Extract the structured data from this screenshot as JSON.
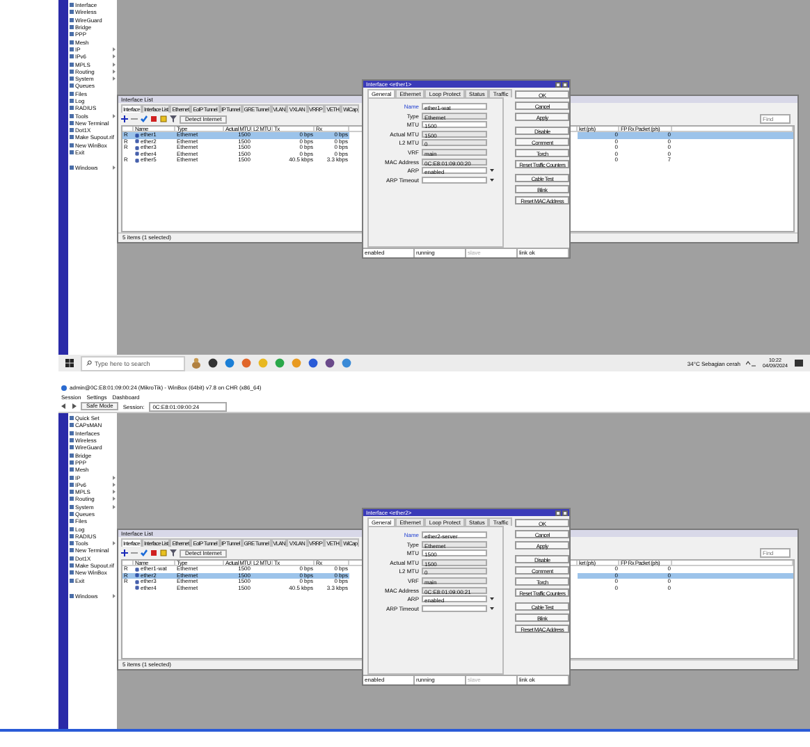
{
  "screens": [
    {
      "sidebar": {
        "items": [
          {
            "label": "Interface",
            "submenu": false
          },
          {
            "label": "Wireless",
            "submenu": false
          },
          {
            "label": "WireGuard",
            "submenu": false
          },
          {
            "label": "Bridge",
            "submenu": false
          },
          {
            "label": "PPP",
            "submenu": false
          },
          {
            "label": "Mesh",
            "submenu": false
          },
          {
            "label": "IP",
            "submenu": true
          },
          {
            "label": "IPv6",
            "submenu": true
          },
          {
            "label": "MPLS",
            "submenu": true
          },
          {
            "label": "Routing",
            "submenu": true
          },
          {
            "label": "System",
            "submenu": true
          },
          {
            "label": "Queues",
            "submenu": false
          },
          {
            "label": "Files",
            "submenu": false
          },
          {
            "label": "Log",
            "submenu": false
          },
          {
            "label": "RADIUS",
            "submenu": false
          },
          {
            "label": "Tools",
            "submenu": true
          },
          {
            "label": "New Terminal",
            "submenu": false
          },
          {
            "label": "Dot1X",
            "submenu": false
          },
          {
            "label": "Make Supout.rif",
            "submenu": false
          },
          {
            "label": "New WinBox",
            "submenu": false
          },
          {
            "label": "Exit",
            "submenu": false
          },
          {
            "label": "Windows",
            "submenu": true
          }
        ]
      },
      "interface_list": {
        "title": "Interface List",
        "tabs": [
          {
            "label": "Interface",
            "selected": true
          },
          {
            "label": "Interface List",
            "selected": false
          },
          {
            "label": "Ethernet",
            "selected": false
          },
          {
            "label": "EoIP Tunnel",
            "selected": false
          },
          {
            "label": "IP Tunnel",
            "selected": false
          },
          {
            "label": "GRE Tunnel",
            "selected": false
          },
          {
            "label": "VLAN",
            "selected": false
          },
          {
            "label": "VXLAN",
            "selected": false
          },
          {
            "label": "VRRP",
            "selected": false
          },
          {
            "label": "VETH",
            "selected": false
          },
          {
            "label": "WiCap",
            "selected": false
          }
        ],
        "toolbar_button": "Detect Internet",
        "find_placeholder": "Find",
        "columns": [
          "Name",
          "Type",
          "Actual MTU",
          "L2 MTU",
          "Tx",
          "Rx",
          "ket (p/s)",
          "FP Rx Packet (p/s)"
        ],
        "rows": [
          {
            "flag": "R",
            "name": "ether1",
            "type": "Ethernet",
            "mtu": "1500",
            "l2mtu": "",
            "tx": "0 bps",
            "rx": "0 bps",
            "fp_tx": "0",
            "fp_rx": "0",
            "selected": true
          },
          {
            "flag": "R",
            "name": "ether2",
            "type": "Ethernet",
            "mtu": "1500",
            "l2mtu": "",
            "tx": "0 bps",
            "rx": "0 bps",
            "fp_tx": "0",
            "fp_rx": "0",
            "selected": false
          },
          {
            "flag": "R",
            "name": "ether3",
            "type": "Ethernet",
            "mtu": "1500",
            "l2mtu": "",
            "tx": "0 bps",
            "rx": "0 bps",
            "fp_tx": "0",
            "fp_rx": "0",
            "selected": false
          },
          {
            "flag": "",
            "name": "ether4",
            "type": "Ethernet",
            "mtu": "1500",
            "l2mtu": "",
            "tx": "0 bps",
            "rx": "0 bps",
            "fp_tx": "0",
            "fp_rx": "0",
            "selected": false
          },
          {
            "flag": "R",
            "name": "ether5",
            "type": "Ethernet",
            "mtu": "1500",
            "l2mtu": "",
            "tx": "40.5 kbps",
            "rx": "3.3 kbps",
            "fp_tx": "0",
            "fp_rx": "7",
            "selected": false
          }
        ],
        "footer": "5 items (1 selected)"
      },
      "dialog": {
        "title": "Interface <ether1>",
        "tabs": [
          {
            "label": "General",
            "selected": true
          },
          {
            "label": "Ethernet",
            "selected": false
          },
          {
            "label": "Loop Protect",
            "selected": false
          },
          {
            "label": "Status",
            "selected": false
          },
          {
            "label": "Traffic",
            "selected": false
          }
        ],
        "fields": [
          {
            "label": "Name",
            "value": "ether1-wat",
            "kind": "text",
            "highlighted": true
          },
          {
            "label": "Type",
            "value": "Ethernet",
            "kind": "readonly",
            "highlighted": false
          },
          {
            "label": "MTU",
            "value": "1500",
            "kind": "text",
            "highlighted": false
          },
          {
            "label": "Actual MTU",
            "value": "1500",
            "kind": "readonly",
            "highlighted": false
          },
          {
            "label": "L2 MTU",
            "value": "0",
            "kind": "readonly",
            "highlighted": false
          },
          {
            "label": "VRF",
            "value": "main",
            "kind": "readonly",
            "highlighted": false
          },
          {
            "label": "MAC Address",
            "value": "0C:E8:01:09:00:20",
            "kind": "readonly",
            "highlighted": false
          },
          {
            "label": "ARP",
            "value": "enabled",
            "kind": "dropdown",
            "highlighted": false
          },
          {
            "label": "ARP Timeout",
            "kind": "dropdown",
            "highlighted": false
          }
        ],
        "buttons": [
          "OK",
          "Cancel",
          "Apply",
          "Disable",
          "Comment",
          "Torch",
          "Reset Traffic Counters",
          "Cable Test",
          "Blink",
          "Reset MAC Address"
        ],
        "status": [
          {
            "text": "enabled",
            "disabled": false
          },
          {
            "text": "running",
            "disabled": false
          },
          {
            "text": "slave",
            "disabled": true
          },
          {
            "text": "link ok",
            "disabled": false
          }
        ]
      },
      "taskbar": {
        "search_placeholder": "Type here to search",
        "weather": "34°C  Sebagian cerah",
        "time": "10:22",
        "date": "04/09/2024"
      }
    },
    {
      "title": "admin@0C:E8:01:09:00:24 (MikroTik) - WinBox (64bit) v7.8 on CHR (x86_64)",
      "menu": [
        "Session",
        "Settings",
        "Dashboard"
      ],
      "toolbar": {
        "safe_mode": "Safe Mode",
        "session_label": "Session:",
        "session": "0C:E8:01:09:00:24"
      },
      "sidebar": {
        "items": [
          {
            "label": "Quick Set",
            "submenu": false
          },
          {
            "label": "CAPsMAN",
            "submenu": false
          },
          {
            "label": "Interfaces",
            "submenu": false
          },
          {
            "label": "Wireless",
            "submenu": false
          },
          {
            "label": "WireGuard",
            "submenu": false
          },
          {
            "label": "Bridge",
            "submenu": false
          },
          {
            "label": "PPP",
            "submenu": false
          },
          {
            "label": "Mesh",
            "submenu": false
          },
          {
            "label": "IP",
            "submenu": true
          },
          {
            "label": "IPv6",
            "submenu": true
          },
          {
            "label": "MPLS",
            "submenu": true
          },
          {
            "label": "Routing",
            "submenu": true
          },
          {
            "label": "System",
            "submenu": true
          },
          {
            "label": "Queues",
            "submenu": false
          },
          {
            "label": "Files",
            "submenu": false
          },
          {
            "label": "Log",
            "submenu": false
          },
          {
            "label": "RADIUS",
            "submenu": false
          },
          {
            "label": "Tools",
            "submenu": true
          },
          {
            "label": "New Terminal",
            "submenu": false
          },
          {
            "label": "Dot1X",
            "submenu": false
          },
          {
            "label": "Make Supout.rif",
            "submenu": false
          },
          {
            "label": "New WinBox",
            "submenu": false
          },
          {
            "label": "Exit",
            "submenu": false
          },
          {
            "label": "Windows",
            "submenu": true
          }
        ]
      },
      "interface_list": {
        "title": "Interface List",
        "tabs": [
          {
            "label": "Interface",
            "selected": true
          },
          {
            "label": "Interface List",
            "selected": false
          },
          {
            "label": "Ethernet",
            "selected": false
          },
          {
            "label": "EoIP Tunnel",
            "selected": false
          },
          {
            "label": "IP Tunnel",
            "selected": false
          },
          {
            "label": "GRE Tunnel",
            "selected": false
          },
          {
            "label": "VLAN",
            "selected": false
          },
          {
            "label": "VXLAN",
            "selected": false
          },
          {
            "label": "VRRP",
            "selected": false
          },
          {
            "label": "VETH",
            "selected": false
          },
          {
            "label": "WiCap",
            "selected": false
          }
        ],
        "toolbar_button": "Detect Internet",
        "find_placeholder": "Find",
        "columns": [
          "Name",
          "Type",
          "Actual MTU",
          "L2 MTU",
          "Tx",
          "Rx",
          "ket (p/s)",
          "FP Rx Packet (p/s)"
        ],
        "rows": [
          {
            "flag": "R",
            "name": "ether1-wat",
            "type": "Ethernet",
            "mtu": "1500",
            "l2mtu": "",
            "tx": "0 bps",
            "rx": "0 bps",
            "fp_tx": "0",
            "fp_rx": "0",
            "selected": false
          },
          {
            "flag": "R",
            "name": "ether2",
            "type": "Ethernet",
            "mtu": "1500",
            "l2mtu": "",
            "tx": "0 bps",
            "rx": "0 bps",
            "fp_tx": "0",
            "fp_rx": "0",
            "selected": true
          },
          {
            "flag": "R",
            "name": "ether3",
            "type": "Ethernet",
            "mtu": "1500",
            "l2mtu": "",
            "tx": "0 bps",
            "rx": "0 bps",
            "fp_tx": "0",
            "fp_rx": "0",
            "selected": false
          },
          {
            "flag": "",
            "name": "ether4",
            "type": "Ethernet",
            "mtu": "1500",
            "l2mtu": "",
            "tx": "40.5 kbps",
            "rx": "3.3 kbps",
            "fp_tx": "0",
            "fp_rx": "0",
            "selected": false
          }
        ],
        "footer": "5 items (1 selected)"
      },
      "dialog": {
        "title": "Interface <ether2>",
        "tabs": [
          {
            "label": "General",
            "selected": true
          },
          {
            "label": "Ethernet",
            "selected": false
          },
          {
            "label": "Loop Protect",
            "selected": false
          },
          {
            "label": "Status",
            "selected": false
          },
          {
            "label": "Traffic",
            "selected": false
          }
        ],
        "fields": [
          {
            "label": "Name",
            "value": "ether2-server",
            "kind": "text",
            "highlighted": true
          },
          {
            "label": "Type",
            "value": "Ethernet",
            "kind": "readonly",
            "highlighted": false
          },
          {
            "label": "MTU",
            "value": "1500",
            "kind": "text",
            "highlighted": false
          },
          {
            "label": "Actual MTU",
            "value": "1500",
            "kind": "readonly",
            "highlighted": false
          },
          {
            "label": "L2 MTU",
            "value": "0",
            "kind": "readonly",
            "highlighted": false
          },
          {
            "label": "VRF",
            "value": "main",
            "kind": "readonly",
            "highlighted": false
          },
          {
            "label": "MAC Address",
            "value": "0C:E8:01:09:00:21",
            "kind": "readonly",
            "highlighted": false
          },
          {
            "label": "ARP",
            "value": "enabled",
            "kind": "dropdown",
            "highlighted": false
          },
          {
            "label": "ARP Timeout",
            "kind": "dropdown",
            "highlighted": false
          }
        ],
        "buttons": [
          "OK",
          "Cancel",
          "Apply",
          "Disable",
          "Comment",
          "Torch",
          "Reset Traffic Counters",
          "Cable Test",
          "Blink",
          "Reset MAC Address"
        ],
        "status": [
          {
            "text": "enabled",
            "disabled": false
          },
          {
            "text": "running",
            "disabled": false
          },
          {
            "text": "slave",
            "disabled": true
          },
          {
            "text": "link ok",
            "disabled": false
          }
        ]
      }
    }
  ]
}
